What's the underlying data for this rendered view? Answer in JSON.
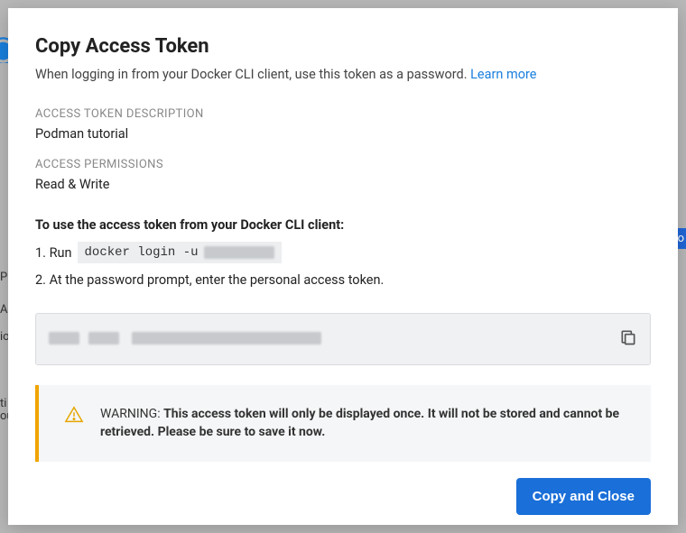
{
  "modal": {
    "title": "Copy Access Token",
    "subtitle_pre": "When logging in from your Docker CLI client, use this token as a password. ",
    "subtitle_link": "Learn more",
    "description_label": "ACCESS TOKEN DESCRIPTION",
    "description_value": "Podman tutorial",
    "permissions_label": "ACCESS PERMISSIONS",
    "permissions_value": "Read & Write",
    "instructions_header": "To use the access token from your Docker CLI client:",
    "step1_prefix": "1. Run",
    "step1_command_visible": "docker login -u",
    "step1_username_redacted": true,
    "step2_text": "2. At the password prompt, enter the personal access token.",
    "token_value_redacted": true,
    "warning_lead": "WARNING:",
    "warning_body": "This access token will only be displayed once. It will not be stored and cannot be retrieved. Please be sure to save it now.",
    "close_button": "Copy and Close"
  }
}
